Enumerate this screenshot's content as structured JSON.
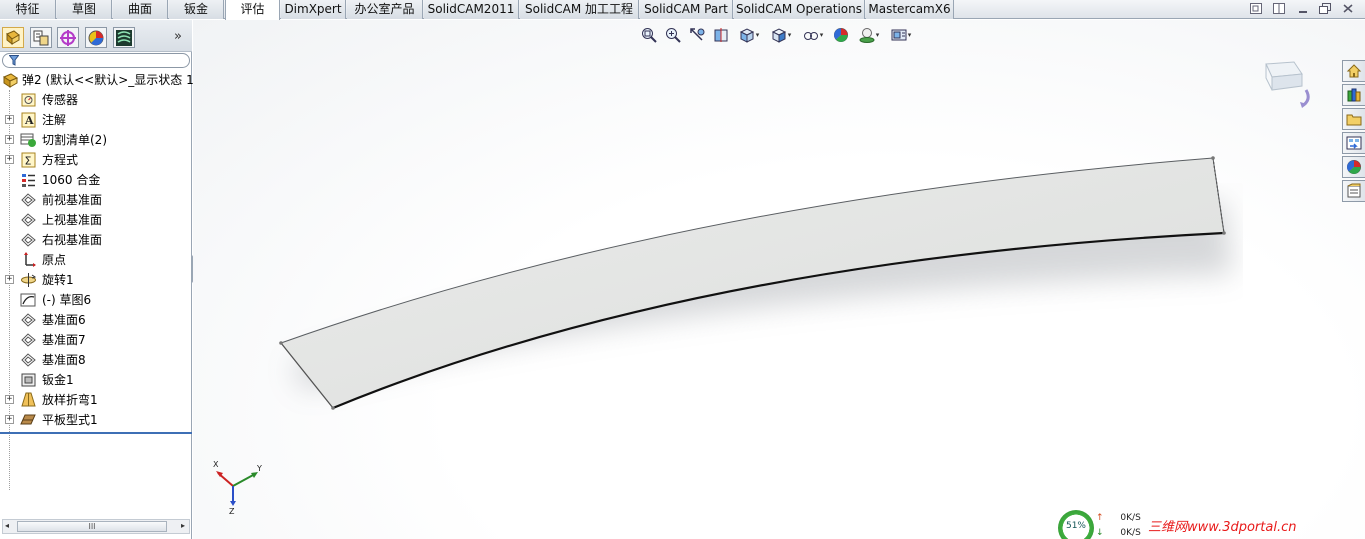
{
  "tabs": [
    {
      "label": "特征",
      "active": false
    },
    {
      "label": "草图",
      "active": false
    },
    {
      "label": "曲面",
      "active": false
    },
    {
      "label": "钣金",
      "active": false
    },
    {
      "label": "评估",
      "active": true
    },
    {
      "label": "DimXpert",
      "active": false
    },
    {
      "label": "办公室产品",
      "active": false
    },
    {
      "label": "SolidCAM2011",
      "active": false
    },
    {
      "label": "SolidCAM 加工工程",
      "active": false
    },
    {
      "label": "SolidCAM Part",
      "active": false
    },
    {
      "label": "SolidCAM Operations",
      "active": false
    },
    {
      "label": "MastercamX6",
      "active": false
    }
  ],
  "panel": {
    "tool_icons": [
      "feature-manager-icon",
      "property-manager-icon",
      "configuration-manager-icon",
      "display-manager-icon",
      "cam-manager-icon"
    ],
    "more_glyph": "»",
    "filter_icon": "filter-icon"
  },
  "tree": {
    "root": {
      "label": "弹2  (默认<<默认>_显示状态 1",
      "icon": "part-icon"
    },
    "items": [
      {
        "label": "传感器",
        "icon": "sensor-icon",
        "expandable": false
      },
      {
        "label": "注解",
        "icon": "annotation-icon",
        "expandable": true
      },
      {
        "label": "切割清单(2)",
        "icon": "cut-list-icon",
        "expandable": true
      },
      {
        "label": "方程式",
        "icon": "equation-icon",
        "expandable": true
      },
      {
        "label": "1060 合金",
        "icon": "material-icon",
        "expandable": false
      },
      {
        "label": "前视基准面",
        "icon": "plane-icon",
        "expandable": false
      },
      {
        "label": "上视基准面",
        "icon": "plane-icon",
        "expandable": false
      },
      {
        "label": "右视基准面",
        "icon": "plane-icon",
        "expandable": false
      },
      {
        "label": "原点",
        "icon": "origin-icon",
        "expandable": false
      },
      {
        "label": "旋转1",
        "icon": "revolve-icon",
        "expandable": true
      },
      {
        "label": "(-) 草图6",
        "icon": "sketch-icon",
        "expandable": false
      },
      {
        "label": "基准面6",
        "icon": "plane-icon",
        "expandable": false
      },
      {
        "label": "基准面7",
        "icon": "plane-icon",
        "expandable": false
      },
      {
        "label": "基准面8",
        "icon": "plane-icon",
        "expandable": false
      },
      {
        "label": "钣金1",
        "icon": "sheet-metal-icon",
        "expandable": false
      },
      {
        "label": "放样折弯1",
        "icon": "lofted-bend-icon",
        "expandable": true
      },
      {
        "label": "平板型式1",
        "icon": "flat-pattern-icon",
        "expandable": true
      }
    ]
  },
  "scrollbar": {
    "thumb_grip": "III",
    "left_arrow": "◂",
    "right_arrow": "▸"
  },
  "splitter_glyph": "‹",
  "headsup_icons": [
    "zoom-to-fit-icon",
    "zoom-to-area-icon",
    "previous-view-icon",
    "section-view-icon",
    "view-orientation-icon",
    "display-style-icon",
    "hide-show-items-icon",
    "edit-appearance-icon",
    "apply-scene-icon",
    "view-settings-icon"
  ],
  "taskpane_icons": [
    "solidworks-resources-icon",
    "design-library-icon",
    "file-explorer-icon",
    "view-palette-icon",
    "appearances-scenes-icon",
    "custom-properties-icon"
  ],
  "triad": {
    "x_label": "X",
    "y_label": "Y",
    "z_label": "Z"
  },
  "status": {
    "percent": "51%",
    "up_speed": "0K/S",
    "down_speed": "0K/S",
    "up_arrow": "↑",
    "down_arrow": "↓"
  },
  "watermark": "三维网www.3dportal.cn",
  "colors": {
    "accent": "#3e6fb5",
    "part_face": "#e6e7e6",
    "watermark": "#e81b1b",
    "status_ring": "#3fae3f"
  }
}
